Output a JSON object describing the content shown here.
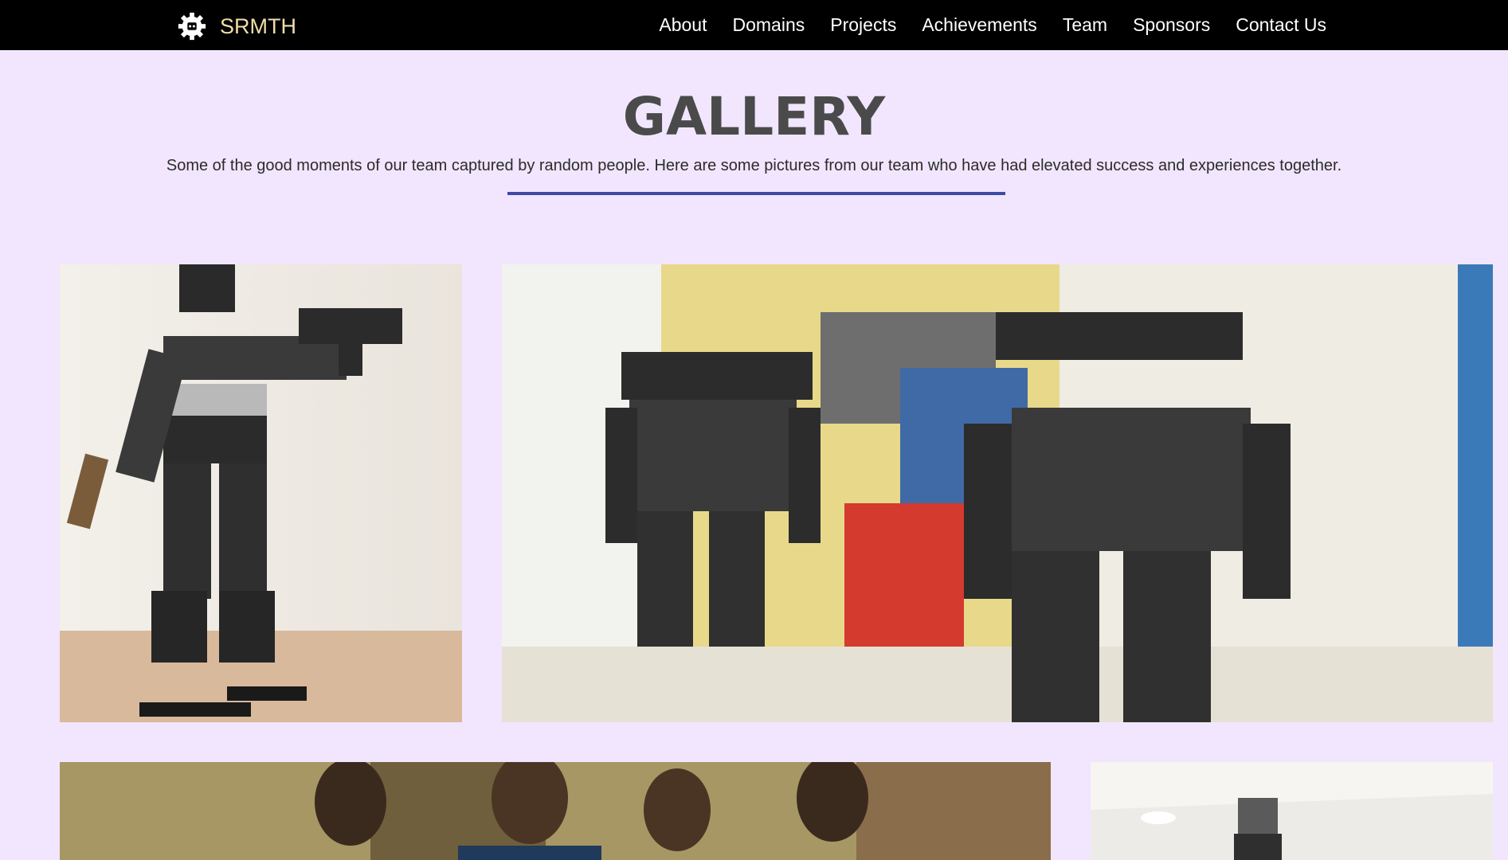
{
  "brand": {
    "name": "SRMTH",
    "icon": "gear-robot-icon"
  },
  "nav": {
    "items": [
      "About",
      "Domains",
      "Projects",
      "Achievements",
      "Team",
      "Sponsors",
      "Contact Us"
    ]
  },
  "gallery": {
    "title": "GALLERY",
    "subtitle": "Some of the good moments of our team captured by random people. Here are some pictures from our team who have had elevated success and experiences together."
  },
  "colors": {
    "page_background": "#f1e6fd",
    "navbar": "#000000",
    "brand_text": "#f0dfa9",
    "divider": "#3f4aa5",
    "title": "#4a4a4a"
  },
  "photos": [
    {
      "name": "humanoid-robot-with-toy-gun"
    },
    {
      "name": "two-humanoid-robots-in-lab"
    },
    {
      "name": "team-members-in-corridor"
    },
    {
      "name": "robot-in-hall"
    }
  ]
}
